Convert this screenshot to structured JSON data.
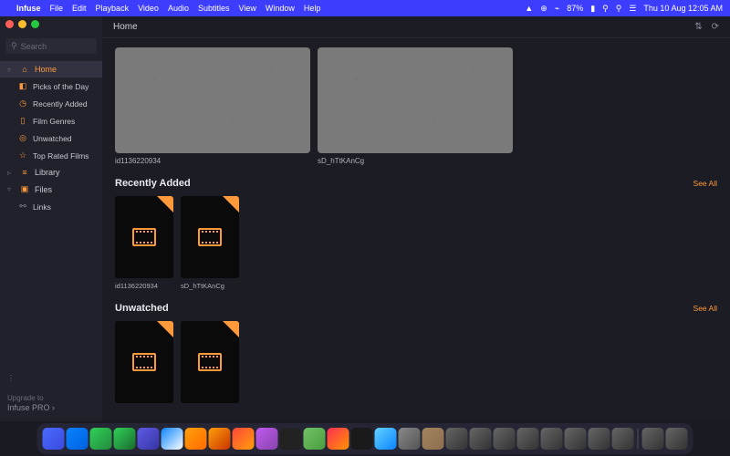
{
  "menubar": {
    "app": "Infuse",
    "items": [
      "File",
      "Edit",
      "Playback",
      "Video",
      "Audio",
      "Subtitles",
      "View",
      "Window",
      "Help"
    ],
    "battery": "87%",
    "datetime": "Thu 10 Aug 12:05 AM"
  },
  "sidebar": {
    "search_placeholder": "Search",
    "home": "Home",
    "items": [
      "Picks of the Day",
      "Recently Added",
      "Film Genres",
      "Unwatched",
      "Top Rated Films"
    ],
    "library": "Library",
    "files": "Files",
    "links": "Links",
    "upgrade_line1": "Upgrade to",
    "upgrade_line2": "Infuse PRO"
  },
  "header": {
    "title": "Home"
  },
  "hero": [
    {
      "label": "id1136220934"
    },
    {
      "label": "sD_hTtKAnCg"
    }
  ],
  "sections": {
    "recent": {
      "title": "Recently Added",
      "seeall": "See All",
      "tiles": [
        {
          "label": "id1136220934"
        },
        {
          "label": "sD_hTtKAnCg"
        }
      ]
    },
    "unwatched": {
      "title": "Unwatched",
      "seeall": "See All",
      "tiles": [
        {
          "label": ""
        },
        {
          "label": ""
        }
      ]
    }
  }
}
